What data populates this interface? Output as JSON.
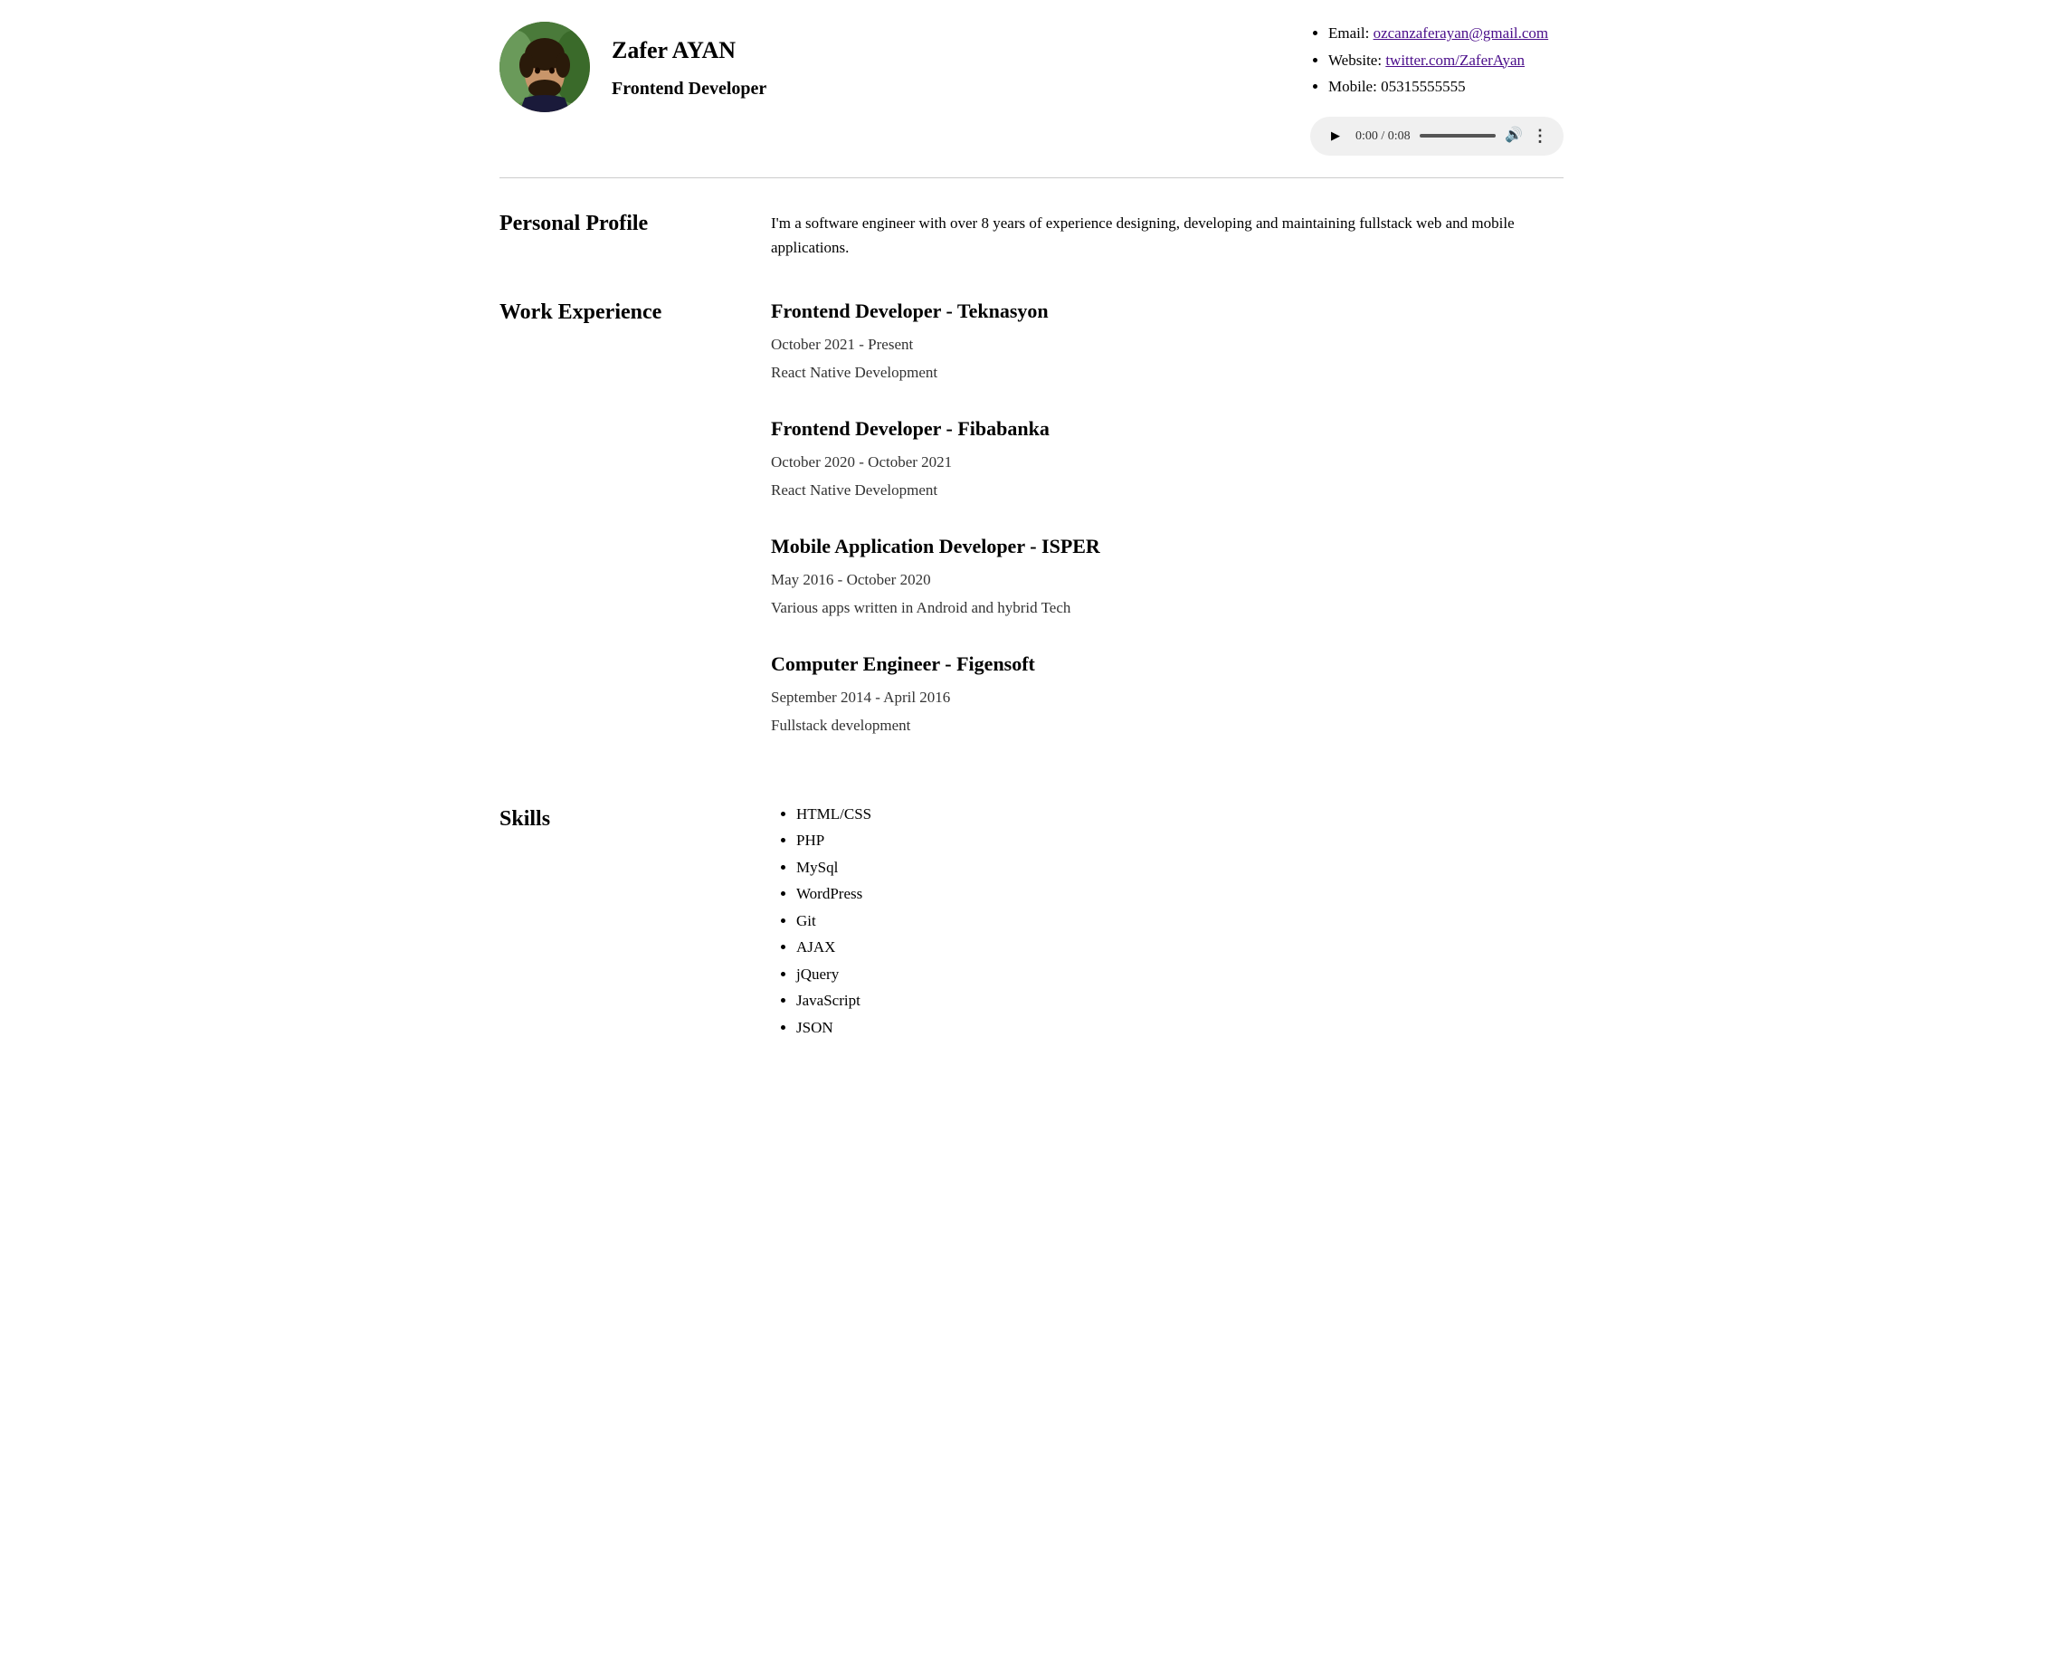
{
  "header": {
    "name": "Zafer AYAN",
    "title": "Frontend Developer",
    "contact": {
      "email_label": "Email: ",
      "email_value": "ozcanzaferayan@gmail.com",
      "email_href": "mailto:ozcanzaferayan@gmail.com",
      "website_label": "Website: ",
      "website_value": "twitter.com/ZaferAyan",
      "website_href": "https://twitter.com/ZaferAyan",
      "mobile_label": "Mobile: ",
      "mobile_value": "05315555555"
    },
    "audio": {
      "time": "0:00 / 0:08"
    }
  },
  "sections": {
    "personal_profile": {
      "label": "Personal Profile",
      "text": "I'm a software engineer with over 8 years of experience designing, developing and maintaining fullstack web and mobile applications."
    },
    "work_experience": {
      "label": "Work Experience",
      "jobs": [
        {
          "title": "Frontend Developer - Teknasyon",
          "dates": "October 2021 - Present",
          "description": "React Native Development"
        },
        {
          "title": "Frontend Developer - Fibabanka",
          "dates": "October 2020 - October 2021",
          "description": "React Native Development"
        },
        {
          "title": "Mobile Application Developer - ISPER",
          "dates": "May 2016 - October 2020",
          "description": "Various apps written in Android and hybrid Tech"
        },
        {
          "title": "Computer Engineer - Figensoft",
          "dates": "September 2014 - April 2016",
          "description": "Fullstack development"
        }
      ]
    },
    "skills": {
      "label": "Skills",
      "items": [
        "HTML/CSS",
        "PHP",
        "MySql",
        "WordPress",
        "Git",
        "AJAX",
        "jQuery",
        "JavaScript",
        "JSON"
      ]
    }
  }
}
